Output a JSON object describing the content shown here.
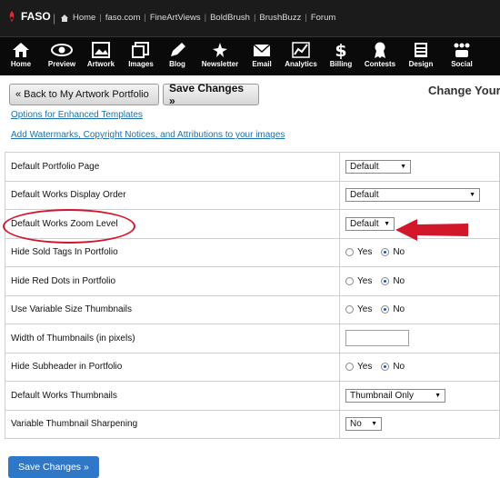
{
  "topbar": {
    "brand": "FASO",
    "links": [
      "Home",
      "faso.com",
      "FineArtViews",
      "BoldBrush",
      "BrushBuzz",
      "Forum"
    ]
  },
  "nav": {
    "items": [
      {
        "label": "Home",
        "icon": "house-icon"
      },
      {
        "label": "Preview",
        "icon": "eye-icon"
      },
      {
        "label": "Artwork",
        "icon": "palette-icon"
      },
      {
        "label": "Images",
        "icon": "images-icon"
      },
      {
        "label": "Blog",
        "icon": "pen-icon"
      },
      {
        "label": "Newsletter",
        "icon": "newsletter-icon"
      },
      {
        "label": "Email",
        "icon": "envelope-icon"
      },
      {
        "label": "Analytics",
        "icon": "chart-icon"
      },
      {
        "label": "Billing",
        "icon": "dollar-icon"
      },
      {
        "label": "Contests",
        "icon": "ribbon-icon"
      },
      {
        "label": "Design",
        "icon": "design-icon"
      },
      {
        "label": "Social",
        "icon": "social-icon"
      }
    ]
  },
  "controls": {
    "back_label": "« Back to My Artwork Portfolio",
    "save_label": "Save Changes »",
    "page_title": "Change Your"
  },
  "links": {
    "enhanced": "Options for Enhanced Templates",
    "watermarks": "Add Watermarks, Copyright Notices, and Attributions to your images"
  },
  "settings": [
    {
      "label": "Default Portfolio Page",
      "type": "select",
      "value": "Default"
    },
    {
      "label": "Default Works Display Order",
      "type": "select",
      "value": "Default"
    },
    {
      "label": "Default Works Zoom Level",
      "type": "select",
      "value": "Default"
    },
    {
      "label": "Hide Sold Tags In Portfolio",
      "type": "radio",
      "yes": "Yes",
      "no": "No",
      "selected": "No"
    },
    {
      "label": "Hide Red Dots in Portfolio",
      "type": "radio",
      "yes": "Yes",
      "no": "No",
      "selected": "No"
    },
    {
      "label": "Use Variable Size Thumbnails",
      "type": "radio",
      "yes": "Yes",
      "no": "No",
      "selected": "No"
    },
    {
      "label": "Width of Thumbnails (in pixels)",
      "type": "text",
      "value": ""
    },
    {
      "label": "Hide Subheader in Portfolio",
      "type": "radio",
      "yes": "Yes",
      "no": "No",
      "selected": "No"
    },
    {
      "label": "Default Works Thumbnails",
      "type": "select",
      "value": "Thumbnail Only"
    },
    {
      "label": "Variable Thumbnail Sharpening",
      "type": "select",
      "value": "No"
    }
  ],
  "bottom": {
    "save_label": "Save Changes »"
  },
  "colors": {
    "topbar": "#1b1b1b",
    "iconbar": "#0a0a0a",
    "link": "#1d70a8",
    "annotation": "#d3172b",
    "primary_button": "#2f78c8"
  }
}
